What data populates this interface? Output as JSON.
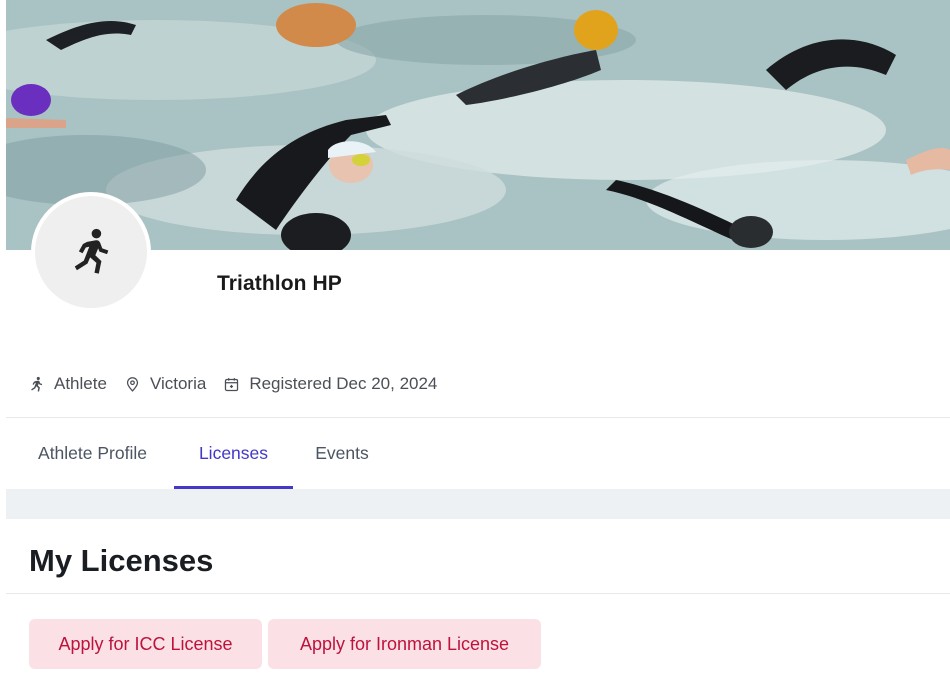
{
  "profile": {
    "name": "Triathlon HP",
    "avatar_icon": "runner-icon"
  },
  "meta": {
    "role": "Athlete",
    "role_icon": "runner-icon",
    "location": "Victoria",
    "location_icon": "location-pin-icon",
    "registered": "Registered Dec 20, 2024",
    "registered_icon": "calendar-icon"
  },
  "tabs": [
    {
      "label": "Athlete Profile",
      "active": false
    },
    {
      "label": "Licenses",
      "active": true
    },
    {
      "label": "Events",
      "active": false
    }
  ],
  "section": {
    "title": "My Licenses"
  },
  "actions": {
    "icc_label": "Apply for ICC License",
    "ironman_label": "Apply for Ironman License"
  },
  "colors": {
    "accent": "#4338ca",
    "button_bg": "#fbe1e6",
    "button_text": "#be123c"
  }
}
